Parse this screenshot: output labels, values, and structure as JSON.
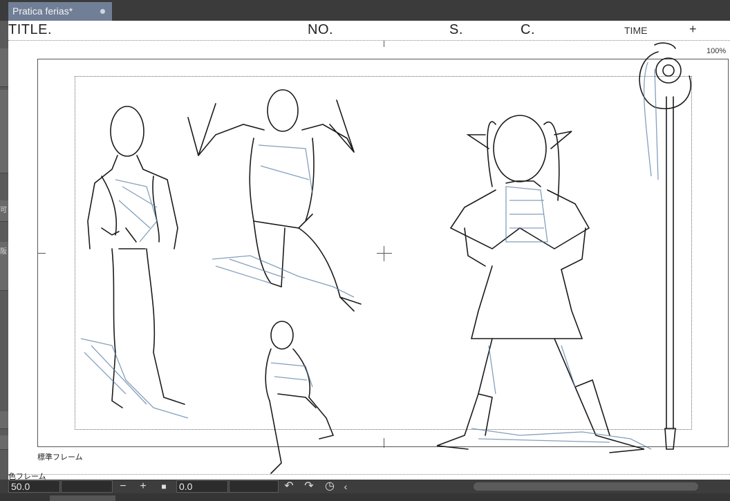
{
  "tab": {
    "title": "Pratica ferias*"
  },
  "canvas_header": {
    "title_label": "TITLE.",
    "no_label": "NO.",
    "s_label": "S.",
    "c_label": "C.",
    "time_label": "TIME",
    "plus_symbol": "+",
    "zoom": "100%"
  },
  "frame_labels": {
    "standard_frame": "標準フレーム",
    "partial_frame": "色フレーム"
  },
  "left_strip": {
    "glyph_1": "可",
    "glyph_2": "阪"
  },
  "bottom_toolbar": {
    "value_1": "50.0",
    "minus": "−",
    "plus": "+",
    "value_2": "0.0",
    "undo_icon": "undo-icon",
    "redo_icon": "redo-icon",
    "timer_icon": "timer-icon",
    "prev": "‹"
  },
  "colors": {
    "tab_active": "#707f96",
    "canvas": "#ffffff",
    "sketch_ink": "#1a1a1a",
    "sketch_blue": "#5b7fa6"
  }
}
